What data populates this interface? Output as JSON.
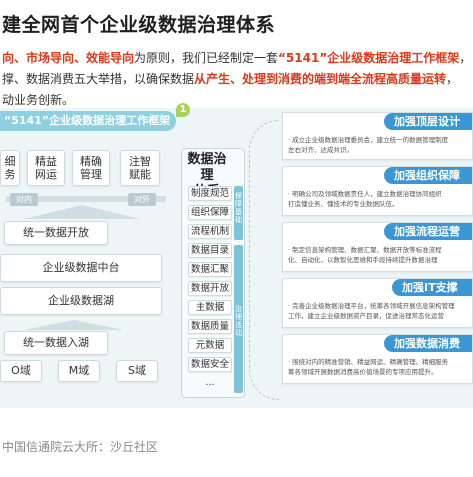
{
  "title": "建全网首个企业级数据治理体系",
  "paragraph": {
    "line1_a": "向、市场导向、效能导向",
    "line1_b": "为原则，我们已经制定一套",
    "line1_c": "“5141”企业级数据治理工作框架",
    "line1_d": "，",
    "line2_a": "撑、数据消费五大举措，以确保数据",
    "line2_b": "从产生、处理到消费的端到端全流程高质量运转",
    "line2_c": "，",
    "line3": "动业务创新。"
  },
  "framework": {
    "banner": "“5141”企业级数据治理工作框架",
    "leaf_number": "1",
    "top_boxes": [
      "细\n务",
      "精益\n网运",
      "精确\n管理",
      "注智\n赋能"
    ],
    "duiwai_left": "对内",
    "duiwai_right": "对外",
    "layers": [
      "统一数据开放",
      "企业级数据中台",
      "企业级数据湖",
      "统一数据入湖"
    ],
    "domains": [
      "O域",
      "M域",
      "S域"
    ],
    "mid_title": "数据治理\n体系",
    "mid_items": [
      "制度规范",
      "组织保障",
      "流程机制",
      "数据目录",
      "数据汇聚",
      "数据开放",
      "主数据",
      "数据质量",
      "元数据",
      "数据安全",
      "..."
    ],
    "strip_top": "保障基础",
    "strip_bottom": "治理活动"
  },
  "right_panel": [
    {
      "heading": "加强顶层设计",
      "lines": [
        "· 成立企业级数据治理委员会，建立统一的数据管理制度",
        "左右对齐、达成共识。"
      ]
    },
    {
      "heading": "加强组织保障",
      "lines": [
        "· 明确公司及领域数据责任人，建立数据治理协同组织",
        "打造懂业务、懂技术的专业数据队伍。"
      ]
    },
    {
      "heading": "加强流程运营",
      "lines": [
        "· 制定信息架构管理、数据汇聚、数据开放等标准流程",
        "化、自动化，以数智化思维和手段持续提升数据治理"
      ]
    },
    {
      "heading": "加强IT支撑",
      "lines": [
        "· 完善企业级数据治理平台，统筹各领域开展信息架构管理",
        "工作，建立企业级数据资产目录，促进治理常态化运营"
      ]
    },
    {
      "heading": "加强数据消费",
      "lines": [
        "· 围绕对内的精准营销、精益网运、精确管理、精细服务",
        "筹各领域开展数据消费高价值场景的专项应用提升。"
      ]
    }
  ],
  "source": "中国信通院云大所：沙丘社区",
  "colors": {
    "accent_red": "#d93a1c",
    "heading_blue": "#3a97d3",
    "banner_teal": "#8fd0e0",
    "leaf_green": "#a6d45f"
  }
}
